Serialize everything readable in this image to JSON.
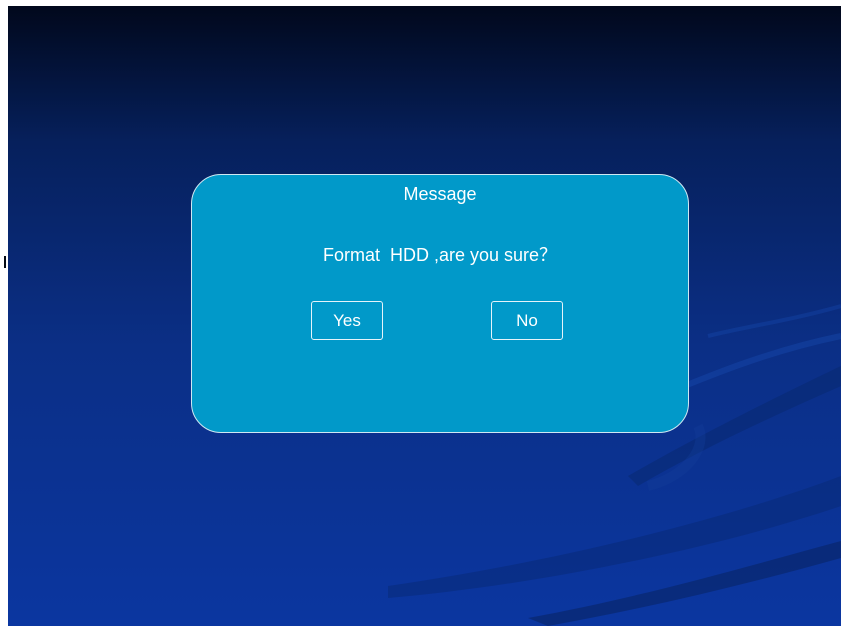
{
  "dialog": {
    "title": "Message",
    "message": "Format  HDD ,are you sure？",
    "yes_label": "Yes",
    "no_label": "No"
  },
  "colors": {
    "background_top": "#01081c",
    "background_bottom": "#0b36a0",
    "dialog_fill": "#0199c9",
    "dialog_border": "#cfe9f3",
    "text": "#ffffff"
  }
}
